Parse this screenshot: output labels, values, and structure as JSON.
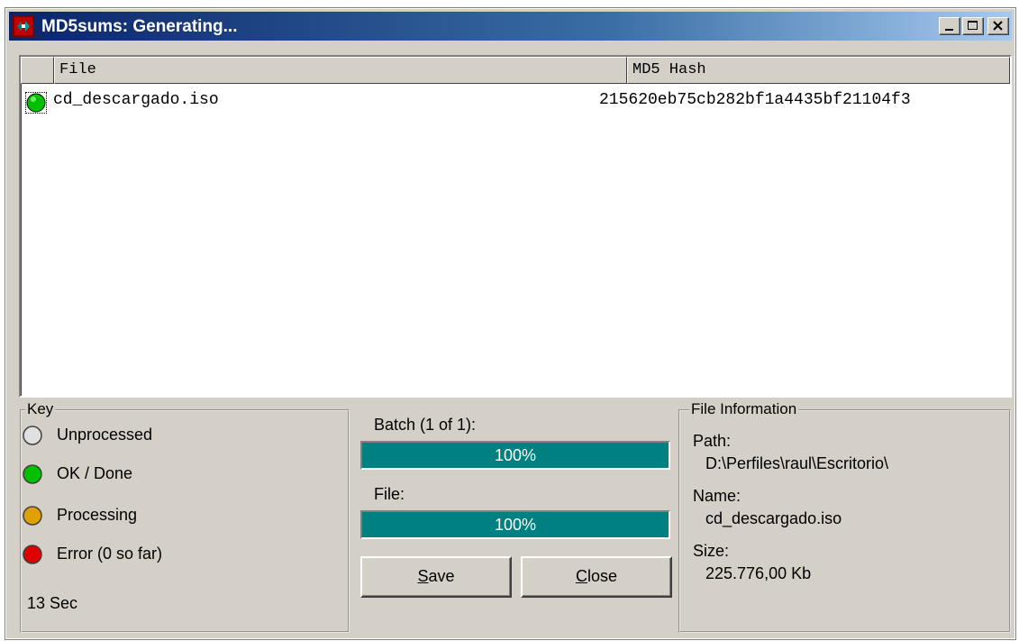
{
  "window": {
    "title": "MD5sums: Generating...",
    "controls": {
      "minimize": "minimize-icon",
      "maximize": "maximize-icon",
      "close": "close-icon"
    }
  },
  "list": {
    "columns": [
      "File",
      "MD5 Hash"
    ],
    "rows": [
      {
        "status": "ok",
        "file": "cd_descargado.iso",
        "hash": "215620eb75cb282bf1a4435bf21104f3"
      }
    ]
  },
  "key": {
    "legend": "Key",
    "items": [
      {
        "label": "Unprocessed",
        "color": "#e0e0e0"
      },
      {
        "label": "OK / Done",
        "color": "#00c000"
      },
      {
        "label": "Processing",
        "color": "#e0a000"
      },
      {
        "label": "Error (0 so far)",
        "color": "#e00000"
      }
    ],
    "elapsed": "13 Sec"
  },
  "progress": {
    "batch_label": "Batch (1 of 1):",
    "batch_percent": 100,
    "batch_text": "100%",
    "file_label": "File:",
    "file_percent": 100,
    "file_text": "100%"
  },
  "buttons": {
    "save": {
      "mnemonic": "S",
      "rest": "ave"
    },
    "close": {
      "mnemonic": "C",
      "rest": "lose"
    }
  },
  "file_info": {
    "legend": "File Information",
    "path_label": "Path:",
    "path_value": "D:\\Perfiles\\raul\\Escritorio\\",
    "name_label": "Name:",
    "name_value": "cd_descargado.iso",
    "size_label": "Size:",
    "size_value": "225.776,00 Kb"
  },
  "colors": {
    "titlebar_start": "#0a246a",
    "progress_fill": "#008080",
    "face": "#d4d0c8"
  }
}
